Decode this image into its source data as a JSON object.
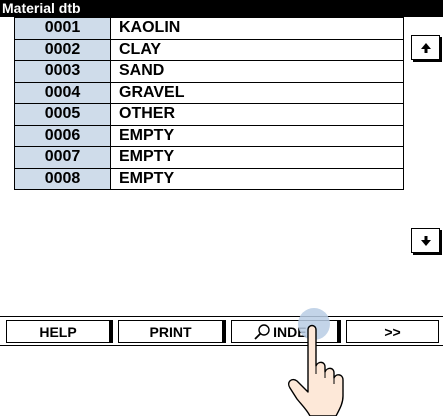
{
  "window": {
    "title": "Material dtb"
  },
  "table": {
    "rows": [
      {
        "code": "0001",
        "name": "KAOLIN"
      },
      {
        "code": "0002",
        "name": "CLAY"
      },
      {
        "code": "0003",
        "name": "SAND"
      },
      {
        "code": "0004",
        "name": "GRAVEL"
      },
      {
        "code": "0005",
        "name": "OTHER"
      },
      {
        "code": "0006",
        "name": "EMPTY"
      },
      {
        "code": "0007",
        "name": "EMPTY"
      },
      {
        "code": "0008",
        "name": "EMPTY"
      }
    ]
  },
  "scroll": {
    "up_icon": "arrow-up-icon",
    "down_icon": "arrow-down-icon"
  },
  "toolbar": {
    "help_label": "HELP",
    "print_label": "PRINT",
    "index_label": "INDEX",
    "index_icon": "magnifier-icon",
    "more_label": ">>"
  },
  "colors": {
    "title_bg": "#000000",
    "title_text": "#ffffff",
    "code_cell_bg": "#cfdcea",
    "touch_highlight": "#b8cde4",
    "hand_skin": "#fde8d8"
  }
}
